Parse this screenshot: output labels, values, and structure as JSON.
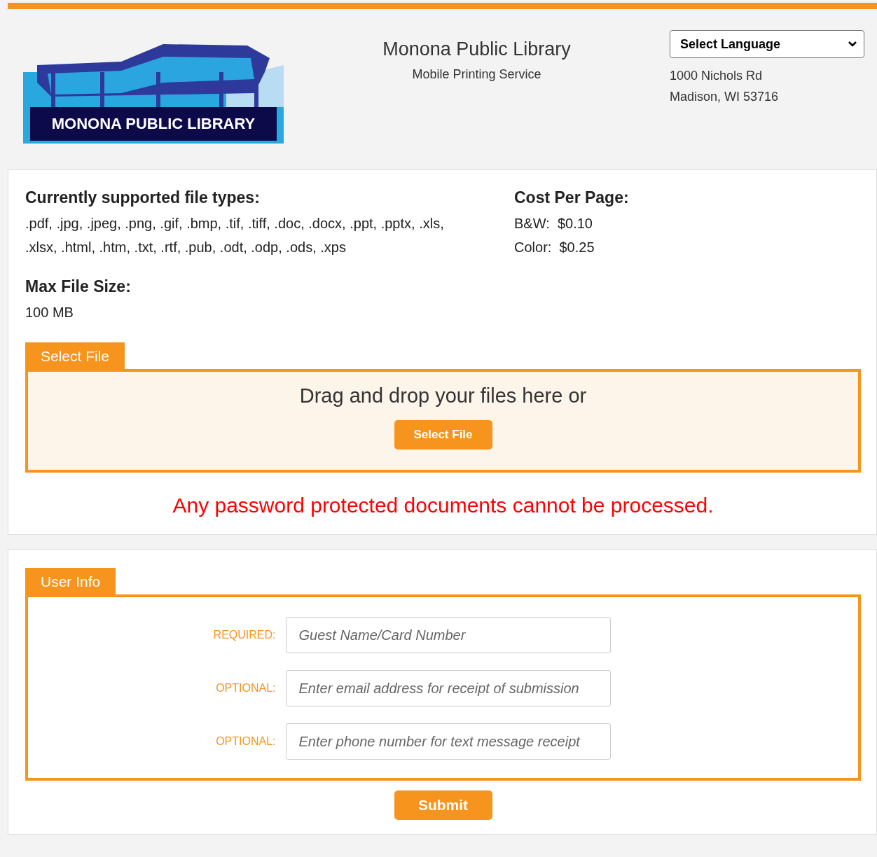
{
  "header": {
    "logo_text": "MONONA PUBLIC LIBRARY",
    "title": "Monona Public Library",
    "subtitle": "Mobile Printing Service",
    "language_select": "Select Language",
    "address": [
      "1000 Nichols Rd",
      "Madison, WI 53716"
    ]
  },
  "info": {
    "file_types_title": "Currently supported file types:",
    "file_types": ".pdf, .jpg, .jpeg, .png, .gif, .bmp, .tif, .tiff, .doc, .docx, .ppt, .pptx, .xls, .xlsx, .html, .htm, .txt, .rtf, .pub, .odt, .odp, .ods, .xps",
    "max_size_title": "Max File Size:",
    "max_size": "100 MB",
    "cost_title": "Cost Per Page:",
    "costs": [
      {
        "label": "B&W:",
        "price": "$0.10"
      },
      {
        "label": "Color:",
        "price": "$0.25"
      }
    ]
  },
  "select_file": {
    "tab": "Select File",
    "drop_text": "Drag and drop your files here or",
    "button": "Select File",
    "warning": "Any password protected documents cannot be processed."
  },
  "user_info": {
    "tab": "User Info",
    "fields": [
      {
        "label": "REQUIRED:",
        "placeholder": "Guest Name/Card Number"
      },
      {
        "label": "OPTIONAL:",
        "placeholder": "Enter email address for receipt of submission"
      },
      {
        "label": "OPTIONAL:",
        "placeholder": "Enter phone number for text message receipt"
      }
    ],
    "submit": "Submit"
  }
}
